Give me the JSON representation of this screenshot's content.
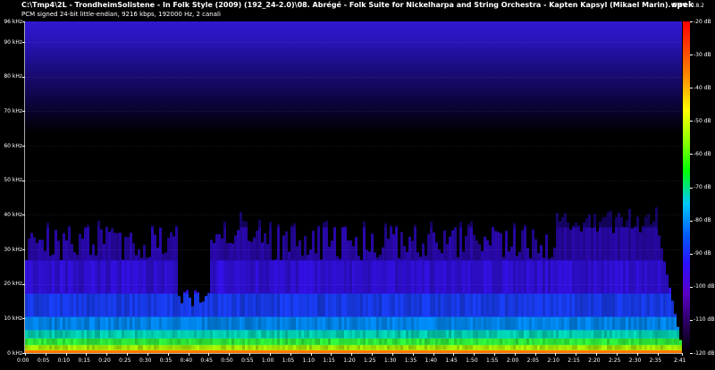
{
  "header": {
    "title": "C:\\Tmp4\\2L - TrondheimSolistene - In Folk Style (2009) (192_24-2.0)\\08. Abrégé - Folk Suite for Nickelharpa and String Orchestra - Kapten Kapsyl (Mikael Marin).wav",
    "info": "PCM signed 24-bit little-endian, 9216 kbps, 192000 Hz, 2 canali",
    "app_name": "spek",
    "app_version": "0.8.2"
  },
  "freq_axis": {
    "labels": [
      "96 kHz",
      "90 kHz",
      "80 kHz",
      "70 kHz",
      "60 kHz",
      "50 kHz",
      "40 kHz",
      "30 kHz",
      "20 kHz",
      "10 kHz",
      "0 kHz"
    ],
    "values": [
      96,
      90,
      80,
      70,
      60,
      50,
      40,
      30,
      20,
      10,
      0
    ],
    "range": [
      0,
      96
    ]
  },
  "time_axis": {
    "labels": [
      "0:00",
      "0:05",
      "0:10",
      "0:15",
      "0:20",
      "0:25",
      "0:30",
      "0:35",
      "0:40",
      "0:45",
      "0:50",
      "0:55",
      "1:00",
      "1:05",
      "1:10",
      "1:15",
      "1:20",
      "1:25",
      "1:30",
      "1:35",
      "1:40",
      "1:45",
      "1:50",
      "1:55",
      "2:00",
      "2:05",
      "2:10",
      "2:15",
      "2:20",
      "2:25",
      "2:30",
      "2:35",
      "2:41"
    ],
    "values": [
      0,
      5,
      10,
      15,
      20,
      25,
      30,
      35,
      40,
      45,
      50,
      55,
      60,
      65,
      70,
      75,
      80,
      85,
      90,
      95,
      100,
      105,
      110,
      115,
      120,
      125,
      130,
      135,
      140,
      145,
      150,
      155,
      161
    ],
    "range": [
      0,
      161
    ]
  },
  "db_scale": {
    "labels": [
      "-20 dB",
      "-30 dB",
      "-40 dB",
      "-50 dB",
      "-60 dB",
      "-70 dB",
      "-80 dB",
      "-90 dB",
      "-100 dB",
      "-110 dB",
      "-120 dB"
    ],
    "values": [
      -20,
      -30,
      -40,
      -50,
      -60,
      -70,
      -80,
      -90,
      -100,
      -110,
      -120
    ],
    "range": [
      -120,
      -20
    ]
  }
}
